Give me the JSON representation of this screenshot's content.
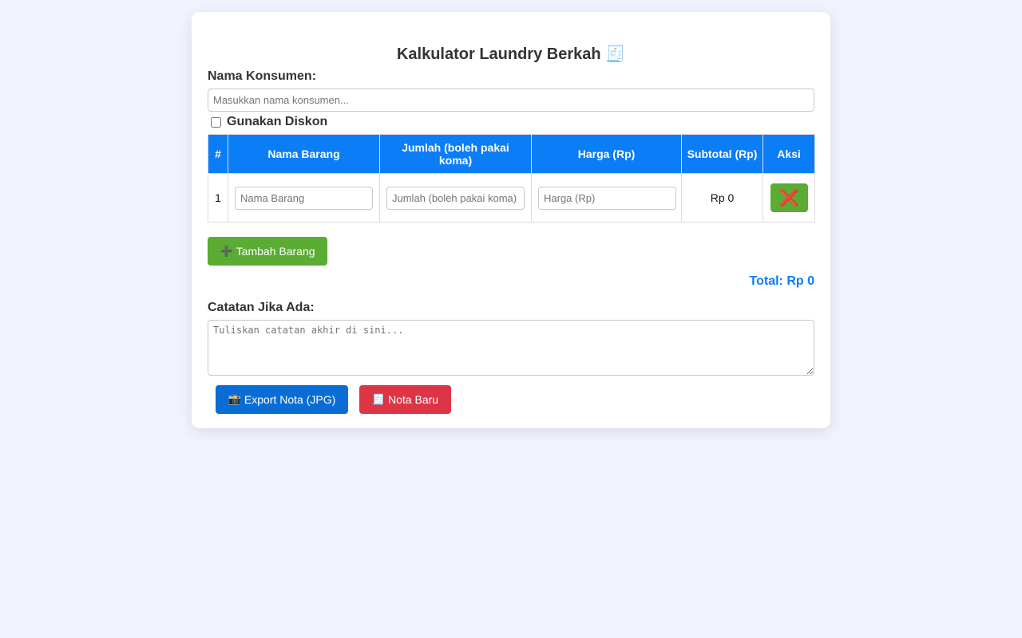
{
  "app": {
    "title": "Kalkulator Laundry Berkah",
    "title_emoji": "🧾"
  },
  "customer": {
    "label": "Nama Konsumen:",
    "placeholder": "Masukkan nama konsumen...",
    "value": ""
  },
  "discount": {
    "label": "Gunakan Diskon",
    "checked": false
  },
  "table": {
    "headers": {
      "no": "#",
      "name": "Nama Barang",
      "qty": "Jumlah (boleh pakai koma)",
      "price": "Harga (Rp)",
      "subtotal": "Subtotal (Rp)",
      "action": "Aksi"
    },
    "rows": [
      {
        "no": "1",
        "name_placeholder": "Nama Barang",
        "qty_placeholder": "Jumlah (boleh pakai koma)",
        "price_placeholder": "Harga (Rp)",
        "subtotal": "Rp 0",
        "delete_icon": "❌"
      }
    ]
  },
  "add_button": {
    "icon": "➕",
    "label": "Tambah Barang"
  },
  "total": {
    "text": "Total: Rp 0"
  },
  "notes": {
    "label": "Catatan Jika Ada:",
    "placeholder": "Tuliskan catatan akhir di sini..."
  },
  "actions": {
    "export": {
      "icon": "📸",
      "label": "Export Nota (JPG)"
    },
    "new": {
      "icon": "🧾",
      "label": "Nota Baru"
    }
  },
  "colors": {
    "background": "#f0f3fd",
    "primary_blue": "#0a7df7",
    "green": "#5aac33",
    "red": "#dd3546",
    "export_blue": "#0a6dd6"
  },
  "icons": {
    "title": "receipt-icon",
    "delete": "cross-mark-icon",
    "add": "plus-icon",
    "export": "camera-icon",
    "new": "receipt-icon"
  }
}
